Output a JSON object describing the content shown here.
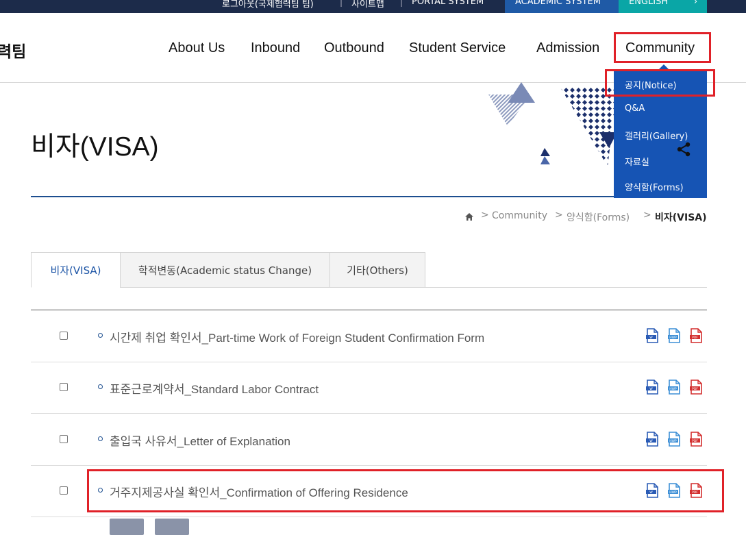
{
  "top_bar": {
    "links": [
      "로그아웃(국제협력팀 팀)",
      "사이트맵",
      "PORTAL SYSTEM"
    ],
    "academic_system": "ACADEMIC SYSTEM",
    "english": "ENGLISH",
    "colors": {
      "bar": "#1c2b4a",
      "academic": "#1f5aa6",
      "english": "#0aa6a6"
    }
  },
  "logo": {
    "text": "력팀"
  },
  "nav": {
    "items": [
      "About Us",
      "Inbound",
      "Outbound",
      "Student Service",
      "Admission",
      "Community"
    ]
  },
  "dropdown": {
    "items": [
      "공지(Notice)",
      "Q&A",
      "갤러리(Gallery)",
      "자료실",
      "양식함(Forms)"
    ],
    "color": "#1654b4"
  },
  "page": {
    "title": "비자(VISA)"
  },
  "breadcrumb": {
    "items": [
      "Community",
      "양식함(Forms)",
      "비자(VISA)"
    ],
    "home_icon": "home-icon"
  },
  "tabs": [
    "비자(VISA)",
    "학적변동(Academic status Change)",
    "기타(Others)"
  ],
  "active_tab": 0,
  "forms": [
    "시간제 취업 확인서_Part-time Work of Foreign Student Confirmation Form",
    "표준근로계약서_Standard Labor Contract",
    "출입국 사유서_Letter of Explanation",
    "거주지제공사실 확인서_Confirmation of Offering Residence"
  ],
  "file_icons": [
    "word-file-icon",
    "hwp-file-icon",
    "pdf-file-icon"
  ],
  "highlight_color": "#e02128"
}
